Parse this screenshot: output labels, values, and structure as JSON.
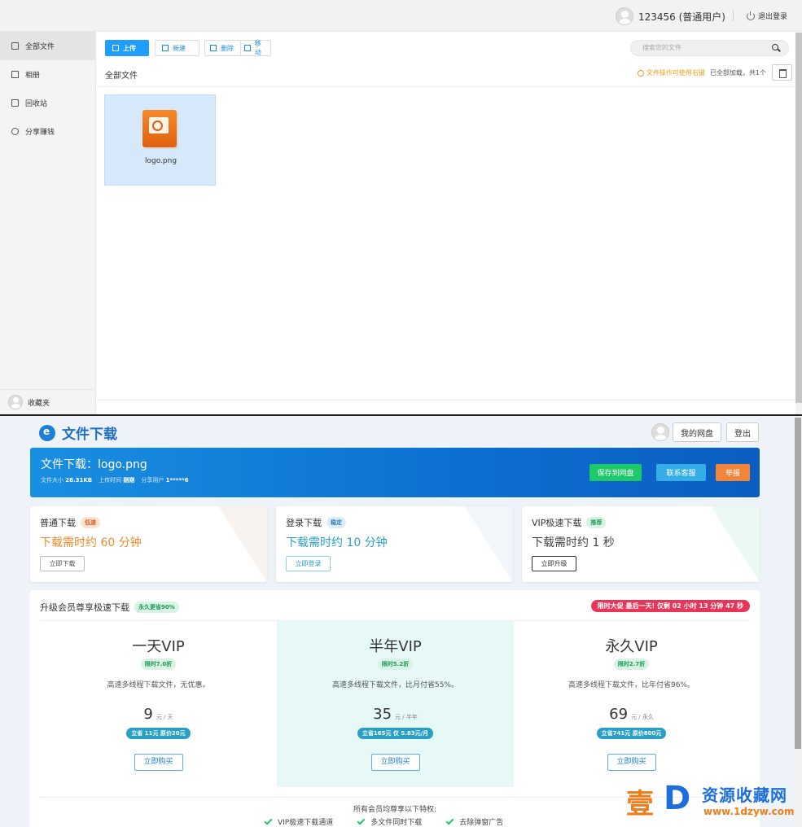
{
  "file_manager": {
    "user": "123456 (普通用户)",
    "logout": "退出登录",
    "sidebar": [
      {
        "label": "全部文件",
        "active": true
      },
      {
        "label": "相册"
      },
      {
        "label": "回收站"
      },
      {
        "label": "分享赚钱"
      }
    ],
    "sidebar_bottom": "收藏夹",
    "toolbar": {
      "upload": "上传",
      "new": "新建",
      "delete": "删除",
      "move": "移动"
    },
    "search_placeholder": "搜索您的文件",
    "breadcrumb": "全部文件",
    "tip_warn": "文件操作可使用右键",
    "tip_count": "已全部加载，共1个",
    "files": [
      {
        "name": "logo.png",
        "icon": "image-file-icon"
      }
    ]
  },
  "download": {
    "brand": "文件下载",
    "my_disk": "我的网盘",
    "logout": "登出",
    "banner": {
      "title": "文件下载：logo.png",
      "size_label": "文件大小",
      "size": "28.31KB",
      "time_label": "上传时间",
      "time": "刚刚",
      "user_label": "分享用户",
      "user": "1*****6",
      "save": "保存到网盘",
      "contact": "联系客服",
      "report": "举报"
    },
    "speeds": [
      {
        "title": "普通下载",
        "tag": "低速",
        "time": "下载需时约 60 分钟",
        "button": "立即下载"
      },
      {
        "title": "登录下载",
        "tag": "稳定",
        "time": "下载需时约 10 分钟",
        "button": "立即登录"
      },
      {
        "title": "VIP极速下载",
        "tag": "推荐",
        "time": "下载需时约 1 秒",
        "button": "立即升级"
      }
    ],
    "vip": {
      "title": "升级会员尊享极速下载",
      "tag": "永久更省90%",
      "promo": "限时大促 最后一天! 仅剩 02 小时 13 分钟 47 秒",
      "plans": [
        {
          "name": "一天VIP",
          "discount": "限时7.0折",
          "desc": "高速多线程下载文件，无优惠。",
          "price": "9",
          "unit": "元 / 天",
          "save": "立省 11元 原价20元",
          "buy": "立即购买"
        },
        {
          "name": "半年VIP",
          "discount": "限时5.2折",
          "desc": "高速多线程下载文件，比月付省55%。",
          "price": "35",
          "unit": "元 / 半年",
          "save": "立省165元 仅 5.83元/月",
          "buy": "立即购买"
        },
        {
          "name": "永久VIP",
          "discount": "限时2.7折",
          "desc": "高速多线程下载文件，比年付省96%。",
          "price": "69",
          "unit": "元 / 永久",
          "save": "立省741元 原价800元",
          "buy": "立即购买"
        }
      ],
      "perks_title": "所有会员均尊享以下特权:",
      "perks": [
        "VIP极速下载通道",
        "多文件同时下载",
        "去除弹窗广告"
      ]
    }
  },
  "watermark": {
    "big": "壹",
    "d": "D",
    "cn": "资源收藏网",
    "url": "www.1dzyw.com"
  },
  "colors": {
    "primary": "#1e9fff",
    "banner": "#0c6fd0",
    "green": "#1ec96a",
    "orange": "#f1863a",
    "promo": "#e8355a"
  }
}
